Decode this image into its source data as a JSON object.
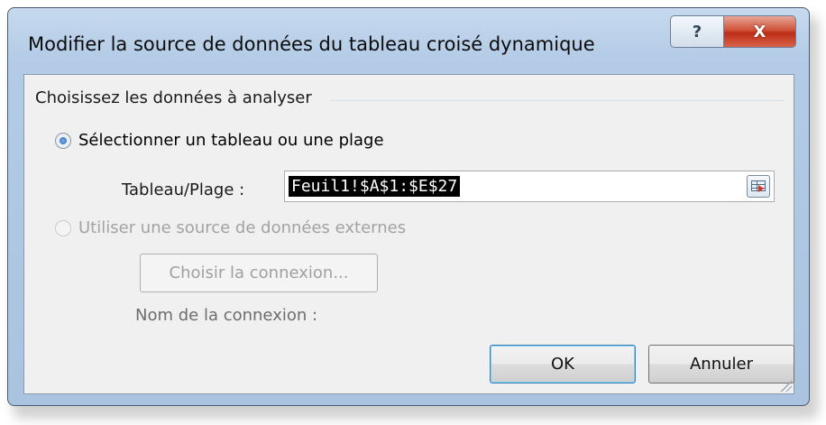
{
  "dialog": {
    "title": "Modifier la source de données du tableau croisé dynamique",
    "help_symbol": "?",
    "close_symbol": "X"
  },
  "section": {
    "label": "Choisissez les données à analyser"
  },
  "options": {
    "select_range": {
      "label": "Sélectionner un tableau ou une plage",
      "checked": true
    },
    "range": {
      "label": "Tableau/Plage :",
      "value": "Feuil1!$A$1:$E$27"
    },
    "external": {
      "label": "Utiliser une source de données externes",
      "checked": false,
      "enabled": false
    },
    "choose_connection_label": "Choisir la connexion...",
    "connection_name_label": "Nom de la connexion :"
  },
  "buttons": {
    "ok": "OK",
    "cancel": "Annuler"
  }
}
